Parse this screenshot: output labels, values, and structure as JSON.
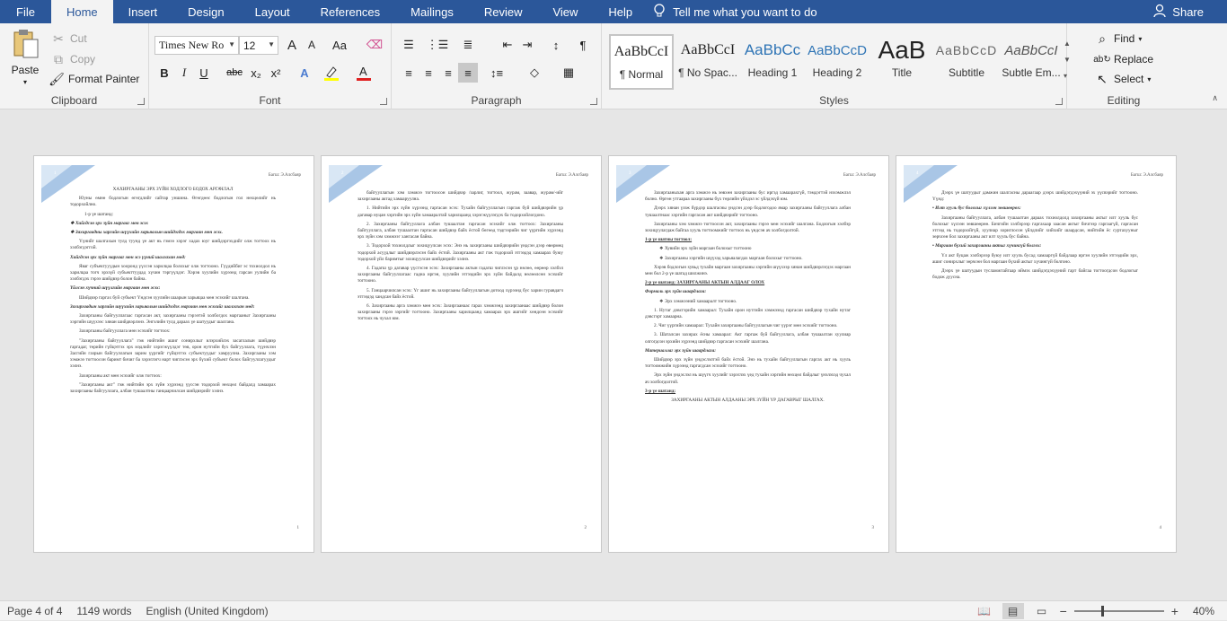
{
  "tabs": [
    "File",
    "Home",
    "Insert",
    "Design",
    "Layout",
    "References",
    "Mailings",
    "Review",
    "View",
    "Help"
  ],
  "tell_me": "Tell me what you want to do",
  "share": "Share",
  "clipboard": {
    "paste": "Paste",
    "cut": "Cut",
    "copy": "Copy",
    "format_painter": "Format Painter",
    "label": "Clipboard"
  },
  "font": {
    "name": "Times New Ro",
    "size": "12",
    "label": "Font",
    "bold": "B",
    "italic": "I",
    "underline": "U",
    "strike": "abc",
    "sub": "x₂",
    "sup": "x²",
    "grow": "A",
    "shrink": "A",
    "case": "Aa"
  },
  "paragraph": {
    "label": "Paragraph"
  },
  "styles": {
    "label": "Styles",
    "items": [
      {
        "preview": "AaBbCcI",
        "name": "¶ Normal"
      },
      {
        "preview": "AaBbCcI",
        "name": "¶ No Spac..."
      },
      {
        "preview": "AaBbCc",
        "name": "Heading 1"
      },
      {
        "preview": "AaBbCcD",
        "name": "Heading 2"
      },
      {
        "preview": "AaB",
        "name": "Title"
      },
      {
        "preview": "AaBbCcD",
        "name": "Subtitle"
      },
      {
        "preview": "AaBbCcI",
        "name": "Subtle Em..."
      }
    ]
  },
  "editing": {
    "find": "Find",
    "replace": "Replace",
    "select": "Select",
    "label": "Editing"
  },
  "pages": [
    {
      "num": "1",
      "header": "Багш: Э.Алсбаяр",
      "paras": [
        {
          "cls": "c",
          "t": "ХАХИРГААНЫ ЭРХ ЗҮЙН ХОДЛОГО БОДОХ АРГАЧЛАЛ"
        },
        {
          "cls": "",
          "t": "Юуны өмнө бодлогын өгөгдлийг сайтар уншина. Өгөгдөөс бодлогын гол нөхцөлийг нь тодорхойлно."
        },
        {
          "cls": "li",
          "t": "1-р үе шатанд:"
        },
        {
          "cls": "b",
          "t": "❖ Хийгдсэн эрх зүйн маргааг мөн эсэх"
        },
        {
          "cls": "b",
          "t": "❖ Захиргаадны харгийн шүүхийн харьяалын шийдэгдэх маргаан мөн эсэх."
        },
        {
          "cls": "",
          "t": "Үүнийг шалгахын тулд туунд үе акт нь гэмээ хэрэг хадах юуг шийдэргэхдийг олж тогтоох нь хэлбэгдэггой."
        },
        {
          "cls": "b",
          "t": "Хийгдсэн эрх зүйн маргааг мөн эсэ үүний шалгахан мөд:"
        },
        {
          "cls": "",
          "t": "Яваг субъектууудын хооронд үүссэн харилцаа болохыг олж тогтооно. Гүүдийбиг эс тохиолдол нь харилцаа тогч эрхзүй субъекттуудад хүчин тэргүүлдэг. Хэрэв хуулийн хүрээнд гарсан уулийн ба хэлбэгдэх гэрээ шийдвэр болон байна."
        },
        {
          "cls": "b",
          "t": "Үйлсэн хүчний шүүлгийн маргаан мөн эсэх:"
        },
        {
          "cls": "",
          "t": "Шийдвэр гаргах буй субъект Үндсэн хуулийн шаарын харьяцаа мөн эсэхийг шалгана."
        },
        {
          "cls": "b",
          "t": "Захиргаадын харгийн шүүхийн харьяалын шийдэгдэх маргаан мөн эсэхийг шалгахан мөд:"
        },
        {
          "cls": "",
          "t": "Захиргааны байгууллагаас гаргасан акт, захиргааны гэрээтэй холбогдох маргааныг Захиргааны хэргийн шүүхээс хянан шийдвэрлэнэ. Энгэлийн тулд дараах үе шатуудыг шалгана."
        },
        {
          "cls": "",
          "t": "Захиргааны байгууллага мөн эсэхийг тогтоох:"
        },
        {
          "cls": "",
          "t": "\"Захиргааны байгууллага\" гэж нийтийн ашиг сонирхлыг илэрхийлэх засаглалын шийдвэр гаргадаг, төрийн гүйцэтгэх эрх мэдлийг хэрэгжүүлдэг төв, орон нутгийн бух байгууллага, түүнчлэн Засгийн газрын байгууллагын зарим үүргийг гүйцэтгэх субъектуудыг хамруулна. Захиргааны хэм хэмжээ тогтоосон баримт бичиг ба хэрэглэгч нарт чиглэсэн эрх бүхий субъект болох байгууллагуудыг хэлнэ."
        },
        {
          "cls": "",
          "t": "Захиргааны акт мөн эсэхийг олж тогтоох:"
        },
        {
          "cls": "",
          "t": "\"Захиргааны акт\" гэж нийтийн эрх зүйн хүрээнд үүссэн тодорхой нөхцөл байдалд хамаарах захиргааны байгууллага, албан тушаалтны ганцаарчилсан шийдвэрийг хэлнэ."
        }
      ]
    },
    {
      "num": "2",
      "header": "Багш: Э.Алсбаяр",
      "paras": [
        {
          "cls": "",
          "t": "байгууллагын хэм хэмжээ тогтоосон шийдвэр /зарлиг, тогтоол, журам, заавар, журам/-ийг захиргааны актад хамааруулна."
        },
        {
          "cls": "",
          "t": "1. Нийтийн эрх зүйн хүрээнд гаргасан эсэх: Тухайн байгууллагын гаргаж буй шийдвэрийн үр дагавар нуцан хэргийн эрх зүйн хамааралтай харилцаанд хэрэгжүүлэгдэх ба тодорхойлогдоно."
        },
        {
          "cls": "",
          "t": "2. Захиргааны байгууллага албан тушаалтан гаргасан эсэхийг олж тогтоох: Захиргааны байгууллага, албан тушаалтан гаргасан шийдвэр байх ёстой бөгөөд тэдгээрийн чиг үүргийн хүрээнд эрх зүйн хэм хэмжээг хангасан байна."
        },
        {
          "cls": "",
          "t": "3. Тодорхой тохиолдлыг зохицуулсан эсэх: Энэ нь захиргааны шийдвэрийн үндсэн дээр өвөрмөц тодорхой асуудлыг шийдвэрлэсэн байх ёстой. Захиргааны акт гэж тодорхой этгээдэд хамаарах буюу тодорхой үйл баримтыг зохицуулсан шийдвэрийг хэлнэ."
        },
        {
          "cls": "",
          "t": "4. Гадагш үр дагавар үүсгэсэн эсэх: Захиргааны актын гадагш чиглэсэн үр нөлөө, өөрөөр хэлбэл захиргааны байгууллагаас гадна иргэн, хуулийн этгээдийн эрх зүйн байдалд нөлөөлсөн эсэхийг тогтооно."
        },
        {
          "cls": "",
          "t": "5. Ганцаарчилсан эсэх: Үг ашиг нь захиргааны байгууллагын дотоод хүрээнд бус харин гуравдагч этгээдэд хандсан байх ёстой."
        },
        {
          "cls": "",
          "t": "6. Захиргааны арга хэмжээ мөн эсэх: Захиргаанаас гарах хэмжээнд захиргаанаас шийдвэр болон захиргааны гэрээ зэргийг тогтооно. Захиргааны харилцаанд хамаарах эрх ашгийг хөндсөн эсэхийг тогтоох нь чухал юм."
        }
      ]
    },
    {
      "num": "3",
      "header": "Багш: Э.Алсбаяр",
      "paras": [
        {
          "cls": "",
          "t": "Захиргааныхан арга хэмжээ нь зөвхөн захиргааны бус иргэд хамаарахгүй, тэмдэгтэй нэхэмжлэл болно. Өргөн утгаараа захиргааны бүх төрлийн үйлдэл эс үйлдэхүй юм."
        },
        {
          "cls": "",
          "t": "Дээрх хянан үзэж бүрдэр шалгасны үндсэн дээр бодлогодоо ямар захиргааны байгууллага албан тушаалтнаас хэргийн гаргасан акт шийдвэрийг тогтооно."
        },
        {
          "cls": "",
          "t": "Захиргааны хэм хэмжээ тогтоосон акт, захиргааны гэрээ мөн эсэхийг шалгана. Бодлогын хэлбэр зохицуулагдаж байгаа хууль тогтоомжийг тогтоох нь үндсэн ач холбогдолтой."
        },
        {
          "cls": "u",
          "t": "1-р үе шатны тогтоол:"
        },
        {
          "cls": "li",
          "t": "❖ Хувийн эрх зүйн маргаан болохыг тогтооно"
        },
        {
          "cls": "li",
          "t": "❖ Захиргааны хэргийн шүүхэд харьяалагдах маргаан болохыг тогтооно."
        },
        {
          "cls": "",
          "t": "Хэрэв бодлогын хувьд тухайн маргаан захиргааны хэргийн шүүхээр хянан шийдвэрлэгдэх маргаан мөн бол 2-р үе шатад шилжинэ."
        },
        {
          "cls": "u",
          "t": "2-р үе шатанд: ЗАХИРГААНЫ АКТЫН АЛДААГ ОЛОХ"
        },
        {
          "cls": "b",
          "t": "Формаль эрх зүйн шаардлага:"
        },
        {
          "cls": "li",
          "t": "❖ Эрх хэмжээний хамааралт тогтооно."
        },
        {
          "cls": "",
          "t": "1. Нутаг дэвсгэрийн хамаарал: Тухайн орон нутгийн хэмжээнд гаргасан шийдвэр тухайн нутаг дэвсгэрт хамаарна."
        },
        {
          "cls": "",
          "t": "2. Чиг үүргийн хамаарал: Тухайн захиргааны байгууллагын чиг үүрэг мөн эсэхийг тогтооно."
        },
        {
          "cls": "",
          "t": "3. Шаталсан захирах ёсны хамаарал: Акт гаргаж буй байгууллага, албан тушаалтан хуулиар олгогдсон эрхийн хүрээнд шийдвэр гаргасан эсэхийг шалгана."
        },
        {
          "cls": "b",
          "t": "Материаллаг эрх зүйн шаардлага:"
        },
        {
          "cls": "",
          "t": "Шийдвэр эрх зүйн үндэслэлтэй байх ёстой. Энэ нь тухайн байгууллагын гаргах акт нь хууль тогтоомжийн хүрээнд гаргагдсан эсэхийг тогтооно."
        },
        {
          "cls": "",
          "t": "Эрх зүйн үндэслэл нь шүүгч хуулийг хэрэглэх үед тухайн хэргийн нөхцөл байдлыг үнэлэхэд чухал ач холбогдолтой."
        },
        {
          "cls": "u",
          "t": "3-р үе шатанд:"
        },
        {
          "cls": "c",
          "t": "ЗАХИРГААНЫ АКТЫН АЛДААНЫ ЭРХ ЗҮЙН ҮР ДАГАВРЫГ ШАЛГАХ."
        }
      ]
    },
    {
      "num": "4",
      "header": "Багш: Э.Алсбаяр",
      "paras": [
        {
          "cls": "",
          "t": "Дээрх үе шатуудыг дамжин шалгасны дараагаар дээрх шийдэгдэхүүний эх үүсвэрийг тогтооно. Үүнд:"
        },
        {
          "cls": "b",
          "t": "• Илт хууль бус болохыг хүлээн зөвшөөрөх:"
        },
        {
          "cls": "",
          "t": "Захиргааны байгууллага, албан тушаалтан дараах тохиолдолд захиргааны актыг илт хууль бус болохыг хүлээн зөвшөөрнө. Бичгийн хэлбэрээр гаргахаар заасан актыг бичгээр гаргаагүй, гаргасан этгээд нь тодорхойгүй, хуулиар хориглосон үйлдлийг хийхийг шаардсан, нийтийн ёс суртахууныг зөрчсөн бол захиргааны акт илт хууль бус байна."
        },
        {
          "cls": "b",
          "t": "• Маргаан бүхий захиргааны актыг хүчингүй болгох:"
        },
        {
          "cls": "",
          "t": "Үл акт буцаж хэлбэрээр буюу илт хууль бусад хамааргүй байдлаар иргэн хуулийн этгээдийн эрх, ашиг сонирхлыг зөрчсөн бол маргаан бүхий актыг хүчингүй болгоно."
        },
        {
          "cls": "",
          "t": "Дээрх үе шатуудын тусламжтайгаар иймэх шийдэгдэхүүний гарт байгаа тогтоогдсон бодлогыг бодож дуусна."
        }
      ]
    }
  ],
  "status": {
    "page": "Page 4 of 4",
    "words": "1149 words",
    "language": "English (United Kingdom)",
    "zoom": "40%"
  }
}
